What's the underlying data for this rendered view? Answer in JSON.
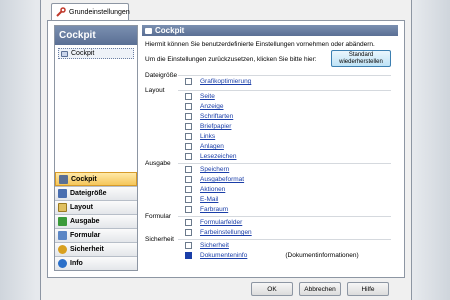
{
  "tab": {
    "label": "Grundeinstellungen",
    "icon": "wrench-icon"
  },
  "nav": {
    "header": "Cockpit",
    "tree_item": "Cockpit",
    "buttons": [
      {
        "label": "Cockpit",
        "icon": "cockpit-icon",
        "active": true
      },
      {
        "label": "Dateigröße",
        "icon": "file-size-icon",
        "active": false
      },
      {
        "label": "Layout",
        "icon": "layout-icon",
        "active": false
      },
      {
        "label": "Ausgabe",
        "icon": "output-icon",
        "active": false
      },
      {
        "label": "Formular",
        "icon": "form-icon",
        "active": false
      },
      {
        "label": "Sicherheit",
        "icon": "key-icon",
        "active": false
      },
      {
        "label": "Info",
        "icon": "info-icon",
        "active": false
      }
    ]
  },
  "main": {
    "header": "Cockpit",
    "desc1": "Hiermit können Sie benutzerdefinierte Einstellungen vornehmen oder abändern.",
    "desc2": "Um die Einstellungen zurückzusetzen, klicken Sie bitte hier:",
    "standard_button": {
      "line1": "Standard",
      "line2": "wiederherstellen"
    },
    "groups": [
      {
        "label": "Dateigröße",
        "options": [
          {
            "label": "Grafikoptimierung",
            "checked": false
          }
        ]
      },
      {
        "label": "Layout",
        "options": [
          {
            "label": "Seite",
            "checked": false
          },
          {
            "label": "Anzeige",
            "checked": false
          },
          {
            "label": "Schriftarten",
            "checked": false
          },
          {
            "label": "Briefpapier",
            "checked": false
          },
          {
            "label": "Links",
            "checked": false
          },
          {
            "label": "Anlagen",
            "checked": false
          },
          {
            "label": "Lesezeichen",
            "checked": false
          }
        ]
      },
      {
        "label": "Ausgabe",
        "options": [
          {
            "label": "Speichern",
            "checked": false
          },
          {
            "label": "Ausgabeformat",
            "checked": false
          },
          {
            "label": "Aktionen",
            "checked": false
          },
          {
            "label": "E-Mail",
            "checked": false
          },
          {
            "label": "Farbraum",
            "checked": false
          }
        ]
      },
      {
        "label": "Formular",
        "options": [
          {
            "label": "Formularfelder",
            "checked": false
          },
          {
            "label": "Farbeinstellungen",
            "checked": false
          }
        ]
      },
      {
        "label": "Sicherheit",
        "options": [
          {
            "label": "Sicherheit",
            "checked": false
          },
          {
            "label": "Dokumenteninfo",
            "checked": true,
            "extra": "(Dokumentinformationen)"
          }
        ]
      }
    ]
  },
  "footer": {
    "ok": "OK",
    "cancel": "Abbrechen",
    "help": "Hilfe"
  },
  "colors": {
    "accent": "#5a6f94",
    "active_nav": "#f5c65a",
    "link": "#1a3ea8"
  }
}
